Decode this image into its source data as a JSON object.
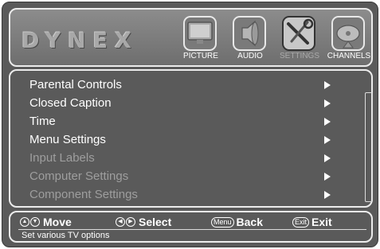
{
  "brand": {
    "logo_text": "DYNEX"
  },
  "tabs": [
    {
      "label": "PICTURE",
      "icon": "tv-icon",
      "active": false
    },
    {
      "label": "AUDIO",
      "icon": "speaker-icon",
      "active": false
    },
    {
      "label": "SETTINGS",
      "icon": "tools-icon",
      "active": true
    },
    {
      "label": "CHANNELS",
      "icon": "satellite-dish-icon",
      "active": false
    }
  ],
  "menu": {
    "items": [
      {
        "label": "Parental Controls",
        "enabled": true
      },
      {
        "label": "Closed Caption",
        "enabled": true
      },
      {
        "label": "Time",
        "enabled": true
      },
      {
        "label": "Menu Settings",
        "enabled": true
      },
      {
        "label": "Input Labels",
        "enabled": false
      },
      {
        "label": "Computer Settings",
        "enabled": false
      },
      {
        "label": "Component Settings",
        "enabled": false
      }
    ]
  },
  "footer": {
    "hints": [
      {
        "key": "up-down-icon",
        "key_text": "",
        "label": "Move"
      },
      {
        "key": "left-right-icon",
        "key_text": "",
        "label": "Select"
      },
      {
        "key": "menu-key-icon",
        "key_text": "Menu",
        "label": "Back"
      },
      {
        "key": "exit-key-icon",
        "key_text": "Exit",
        "label": "Exit"
      }
    ],
    "status": "Set various TV options"
  }
}
